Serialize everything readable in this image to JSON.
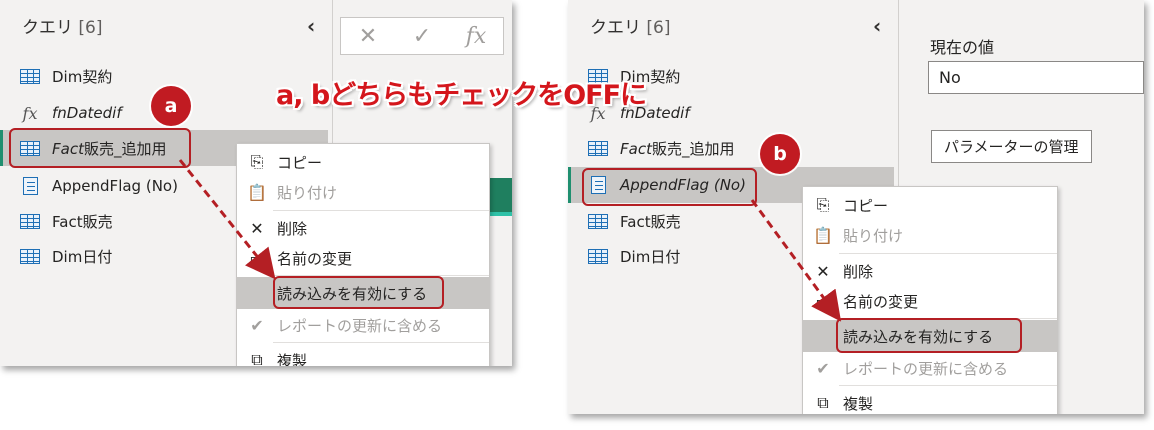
{
  "note": "a, bどちらもチェックをOFFに",
  "badges": {
    "a": "a",
    "b": "b"
  },
  "left_panel": {
    "header": {
      "title": "クエリ",
      "count": "[6]"
    },
    "queries": [
      {
        "label": "Dim契約",
        "icon": "table-icon"
      },
      {
        "label": "fnDatedif",
        "icon": "function-icon"
      },
      {
        "label_italic": "Fact",
        "label_rest": "販売_追加用",
        "icon": "table-icon",
        "selected": true
      },
      {
        "label": "AppendFlag (No)",
        "icon": "parameter-icon"
      },
      {
        "label": "Fact販売",
        "icon": "table-icon"
      },
      {
        "label": "Dim日付",
        "icon": "table-icon"
      }
    ],
    "formula_bar": {
      "cancel": "✕",
      "commit": "✓",
      "fx": "fx"
    },
    "context_menu": [
      {
        "label": "コピー",
        "icon": "copy-icon",
        "enabled": true
      },
      {
        "label": "貼り付け",
        "icon": "paste-icon",
        "enabled": false
      },
      {
        "label": "削除",
        "icon": "delete-icon",
        "enabled": true
      },
      {
        "label": "名前の変更",
        "icon": "rename-icon",
        "enabled": true
      },
      {
        "label": "読み込みを有効にする",
        "icon": "",
        "enabled": true,
        "highlighted": true
      },
      {
        "label": "レポートの更新に含める",
        "icon": "check-icon",
        "enabled": false
      },
      {
        "label": "複製",
        "icon": "duplicate-icon",
        "enabled": true
      }
    ]
  },
  "right_panel": {
    "header": {
      "title": "クエリ",
      "count": "[6]"
    },
    "queries": [
      {
        "label": "Dim契約"
      },
      {
        "label": "fnDatedif"
      },
      {
        "label_italic": "Fact",
        "label_rest": "販売_追加用"
      },
      {
        "label": "AppendFlag (No)",
        "selected": true
      },
      {
        "label": "Fact販売"
      },
      {
        "label": "Dim日付"
      }
    ],
    "current_value_label": "現在の値",
    "current_value": "No",
    "manage_params_button": "パラメーターの管理",
    "context_menu": [
      {
        "label": "コピー"
      },
      {
        "label": "貼り付け"
      },
      {
        "label": "削除"
      },
      {
        "label": "名前の変更"
      },
      {
        "label": "読み込みを有効にする"
      },
      {
        "label": "レポートの更新に含める"
      },
      {
        "label": "複製"
      }
    ]
  },
  "colors": {
    "annotation_red": "#c11b22",
    "selection_accent": "#1f8f6f",
    "icon_blue": "#1e6fb5"
  }
}
